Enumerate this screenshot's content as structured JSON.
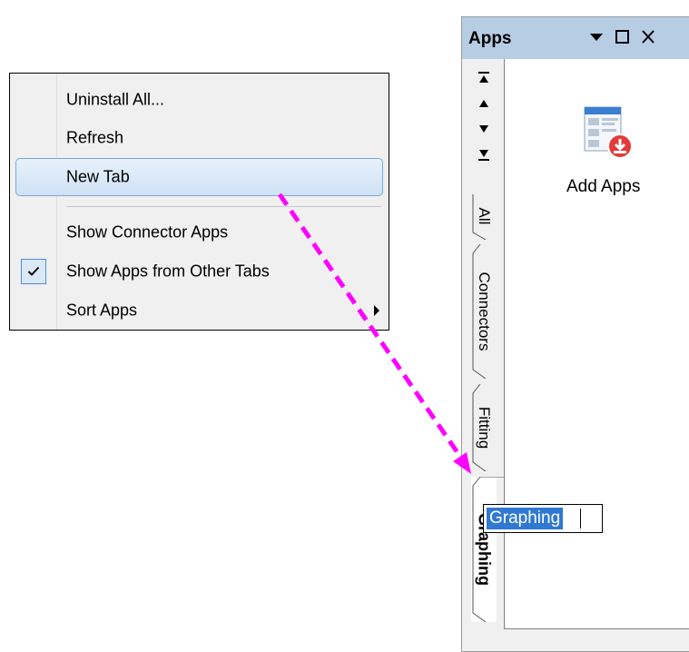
{
  "context_menu": {
    "items": [
      {
        "label": "Uninstall All..."
      },
      {
        "label": "Refresh"
      },
      {
        "label": "New Tab"
      },
      {
        "label": "Show Connector Apps"
      },
      {
        "label": "Show Apps from Other Tabs",
        "checked": true
      },
      {
        "label": "Sort Apps",
        "submenu": true
      }
    ],
    "highlighted_item": "New Tab"
  },
  "apps_panel": {
    "title": "Apps",
    "title_buttons": [
      "dropdown-arrow-icon",
      "maximize-icon",
      "close-icon"
    ],
    "nav_buttons": [
      "first-icon",
      "up-icon",
      "down-icon",
      "last-icon"
    ],
    "tabs": [
      {
        "label": "All"
      },
      {
        "label": "Connectors"
      },
      {
        "label": "Fitting"
      },
      {
        "label": "Graphing",
        "active": true
      }
    ],
    "apps": [
      {
        "label": "Add Apps",
        "icon": "add-apps-icon"
      }
    ],
    "rename_field": {
      "value": "Graphing",
      "selected": true
    }
  },
  "annotation": {
    "type": "dashed-arrow",
    "color": "#ff00ff"
  },
  "colors": {
    "titlebar": "#b7cde4",
    "highlight_border": "#7aa9d8",
    "selection": "#3078d2",
    "annotation": "#ff00ff"
  }
}
